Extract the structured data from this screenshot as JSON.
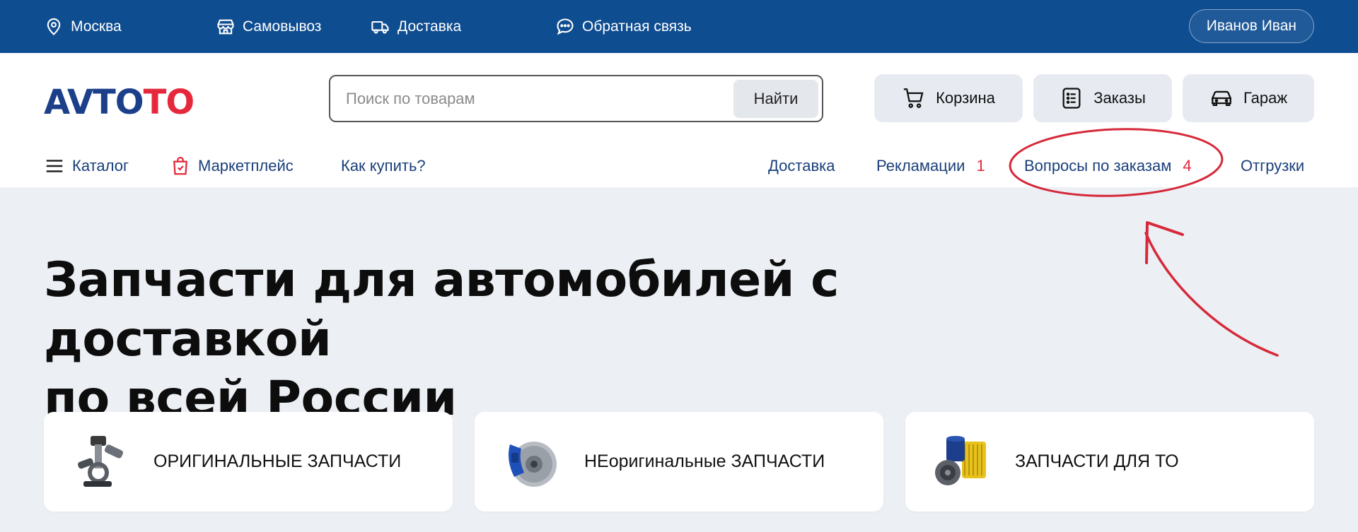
{
  "topbar": {
    "city": "Москва",
    "pickup": "Самовывоз",
    "delivery": "Доставка",
    "feedback": "Обратная связь",
    "user": "Иванов Иван"
  },
  "header": {
    "logo_part1": "AVTO",
    "logo_part2": "TO",
    "search_placeholder": "Поиск по товарам",
    "search_button": "Найти",
    "cart": "Корзина",
    "orders": "Заказы",
    "garage": "Гараж"
  },
  "nav": {
    "catalog": "Каталог",
    "marketplace": "Маркетплейс",
    "how_to_buy": "Как купить?",
    "delivery": "Доставка",
    "claims": "Рекламации",
    "claims_count": "1",
    "order_questions": "Вопросы по заказам",
    "order_questions_count": "4",
    "shipments": "Отгрузки"
  },
  "hero": {
    "title_line1": "Запчасти для автомобилей с доставкой",
    "title_line2": "по всей России"
  },
  "cards": [
    {
      "label": "ОРИГИНАЛЬНЫЕ ЗАПЧАСТИ",
      "icon": "engine-parts-icon"
    },
    {
      "label": "НЕоригинальные ЗАПЧАСТИ",
      "icon": "brake-disc-icon"
    },
    {
      "label": "ЗАПЧАСТИ ДЛЯ ТО",
      "icon": "oil-filters-icon"
    }
  ],
  "colors": {
    "brand_blue": "#0f4d91",
    "accent_red": "#e5283c",
    "nav_text": "#1a3f7a",
    "page_bg": "#ecf0f5"
  }
}
